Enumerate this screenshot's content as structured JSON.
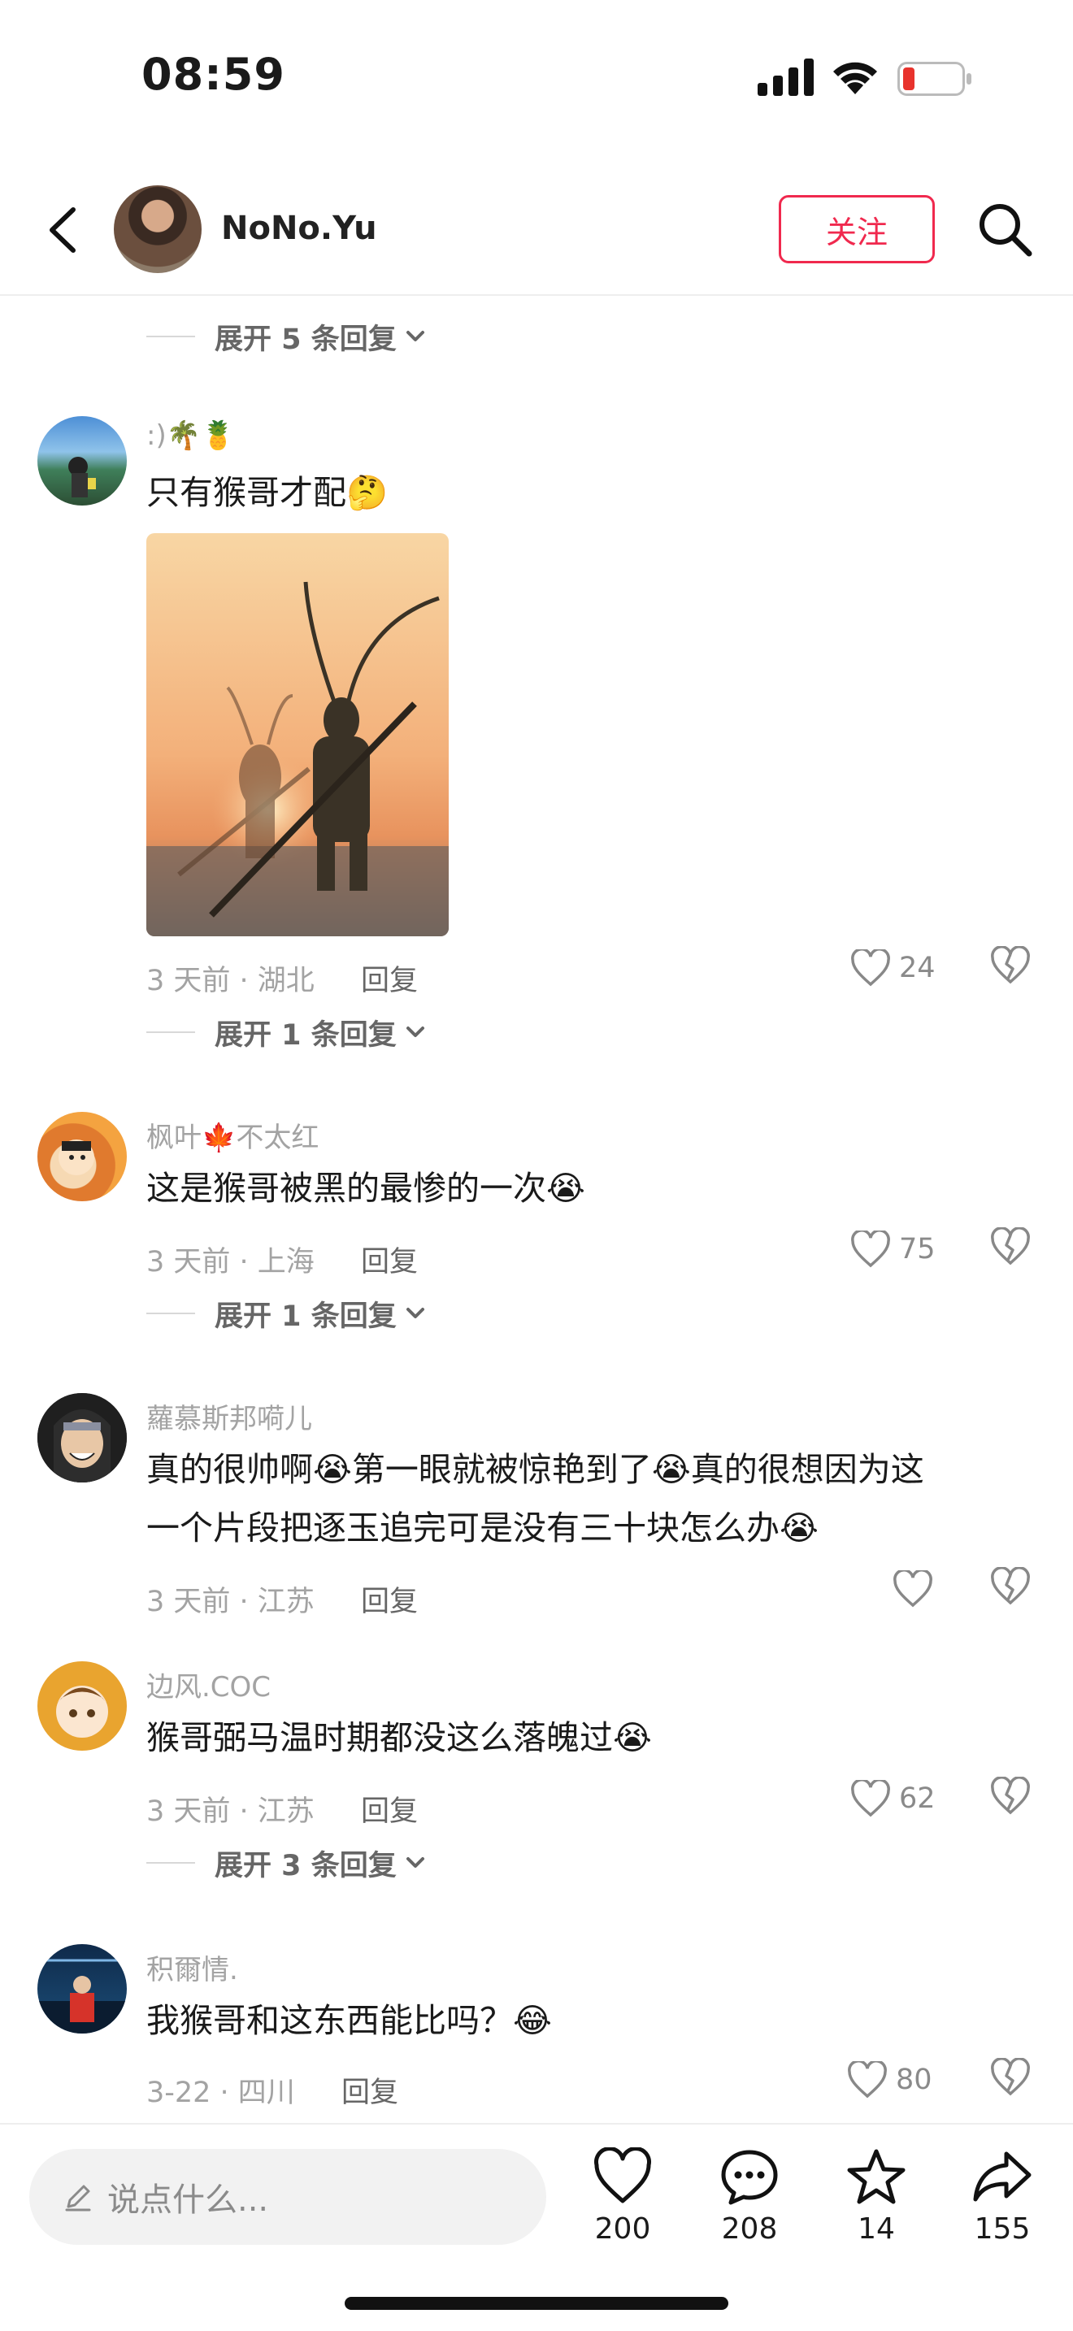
{
  "status": {
    "time": "08:59"
  },
  "header": {
    "name": "NoNo.Yu",
    "follow_label": "关注"
  },
  "toggles": {
    "t1": "展开 5 条回复",
    "t2": "展开 1 条回复",
    "t3": "展开 1 条回复",
    "t4": "展开 3 条回复"
  },
  "comments": [
    {
      "user": ":)🌴🍍",
      "text": "只有猴哥才配🤔",
      "meta": "3 天前 · 湖北",
      "reply": "回复",
      "likes": "24"
    },
    {
      "user": "枫叶🍁不太红",
      "text": "这是猴哥被黑的最惨的一次😭",
      "meta": "3 天前 · 上海",
      "reply": "回复",
      "likes": "75"
    },
    {
      "user": "蘿慕斯邦嗬儿",
      "text_line1": "真的很帅啊😭第一眼就被惊艳到了😭真的很想因为这",
      "text_line2": "一个片段把逐玉追完可是没有三十块怎么办😭",
      "meta": "3 天前 · 江苏",
      "reply": "回复",
      "likes": ""
    },
    {
      "user": "边风.COC",
      "text": "猴哥弼马温时期都没这么落魄过😭",
      "meta": "3 天前 · 江苏",
      "reply": "回复",
      "likes": "62"
    },
    {
      "user": "积爾情.",
      "text": "我猴哥和这东西能比吗？😂",
      "meta": "3-22 · 四川",
      "reply": "回复",
      "likes": "80"
    }
  ],
  "bottom": {
    "input_placeholder": "说点什么...",
    "likes": "200",
    "comments": "208",
    "favorites": "14",
    "shares": "155"
  }
}
